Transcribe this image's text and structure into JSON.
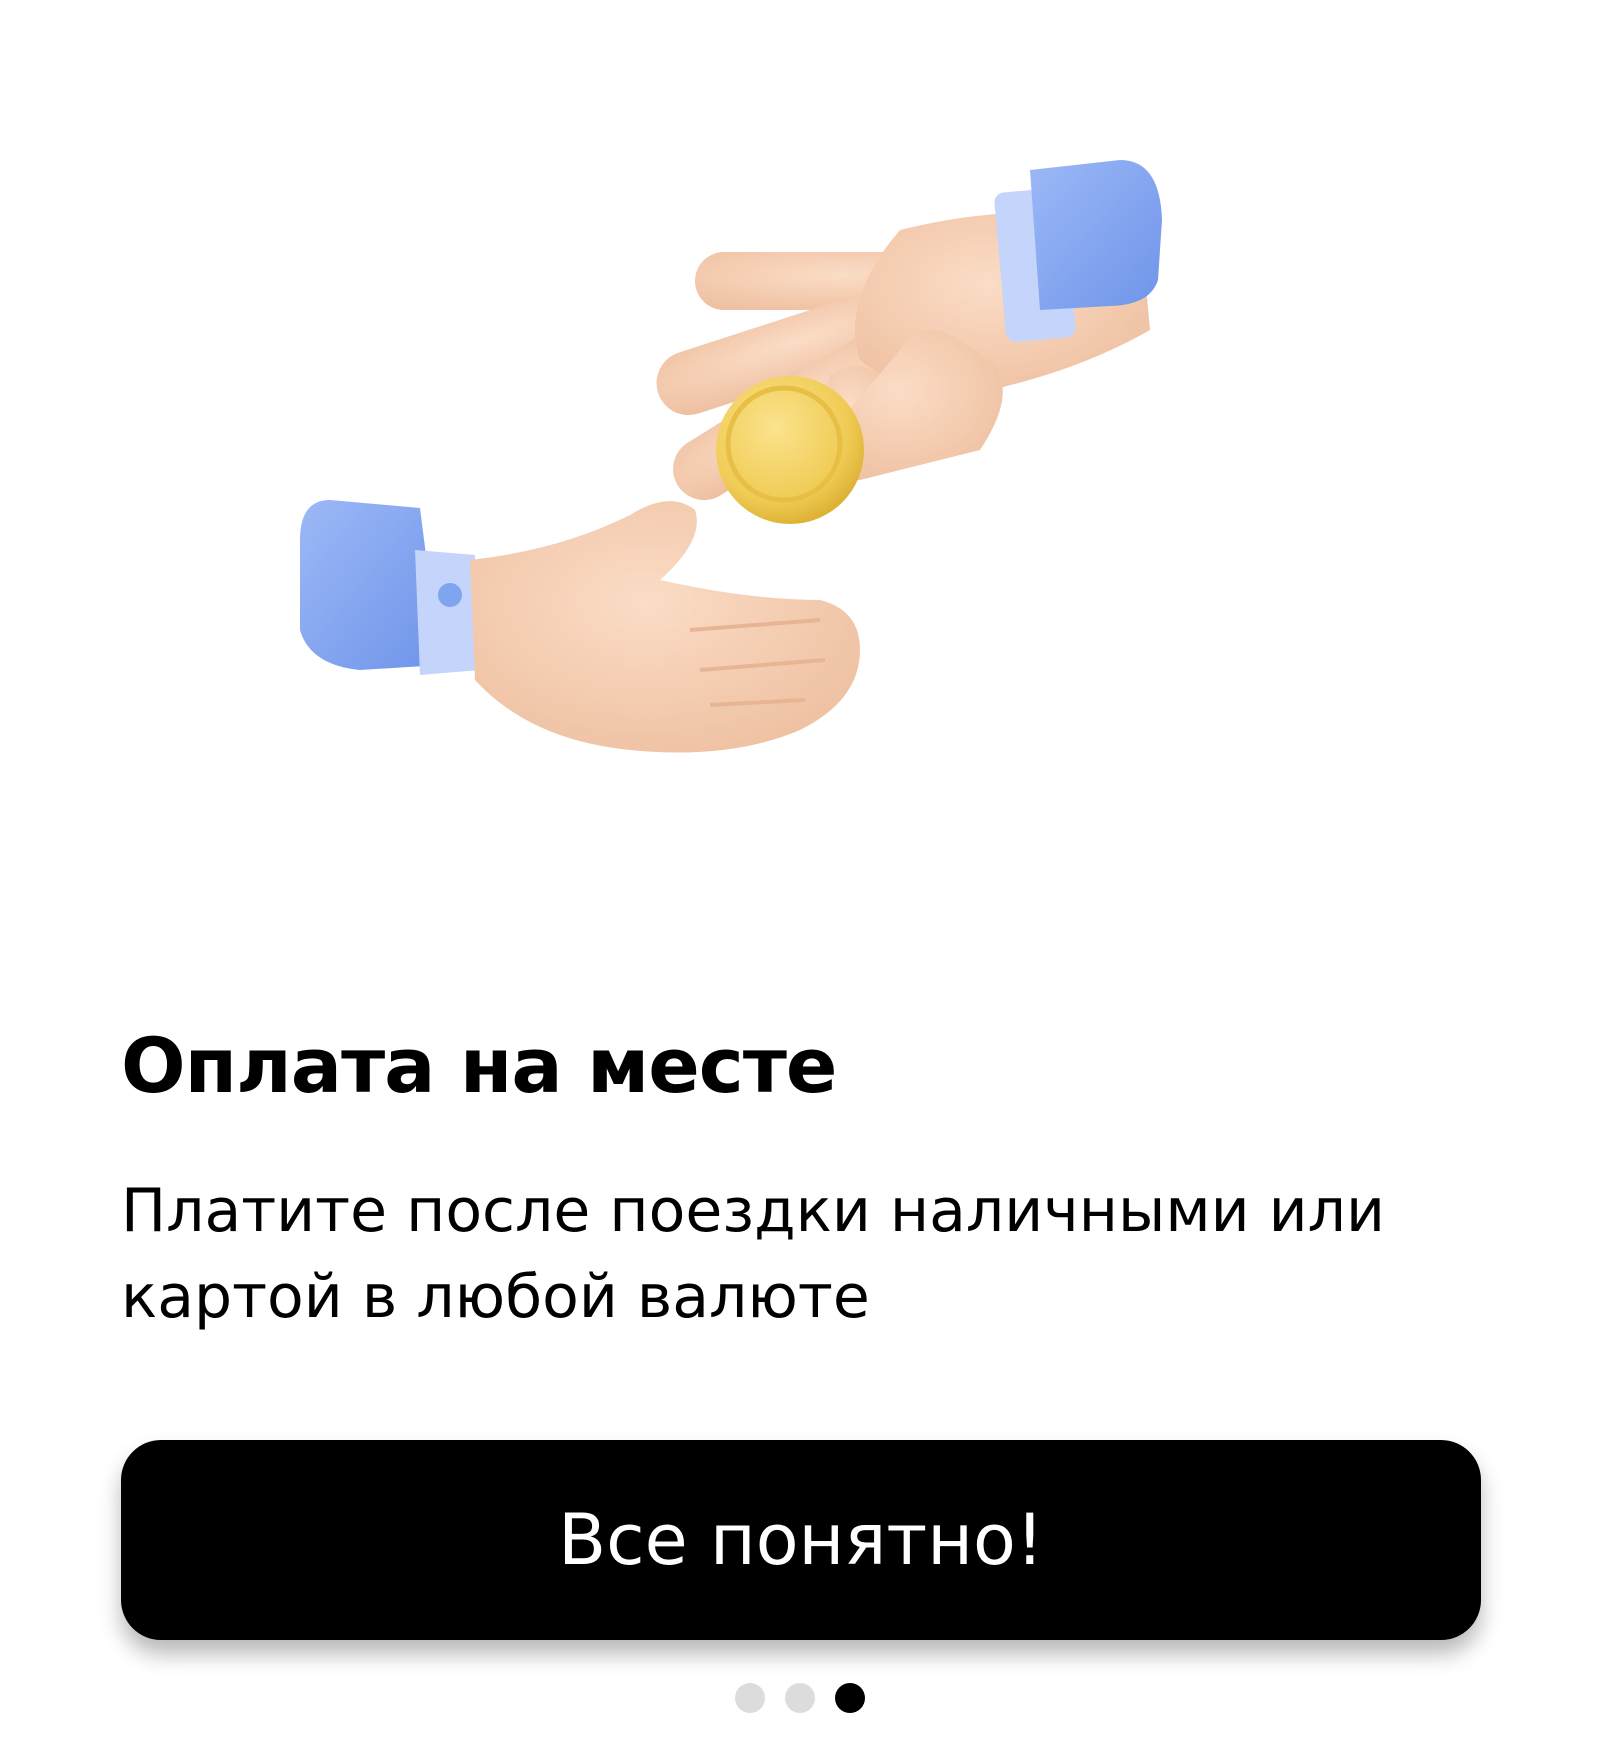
{
  "onboarding": {
    "illustration": "hands-exchanging-coin-illustration",
    "title": "Оплата на месте",
    "subtitle": "Платите после поездки наличными или картой в любой валюте",
    "button_label": "Все понятно!",
    "pager": {
      "pages": 3,
      "current": 3
    }
  },
  "colors": {
    "background": "#ffffff",
    "button_background": "#000000",
    "button_text": "#ffffff",
    "dot_inactive": "#dcdcdc",
    "dot_active": "#000000",
    "sleeve": "#7fa4f0",
    "cuff": "#c5d4fa",
    "skin": "#f3c9ac",
    "coin": "#f1cf5b"
  }
}
